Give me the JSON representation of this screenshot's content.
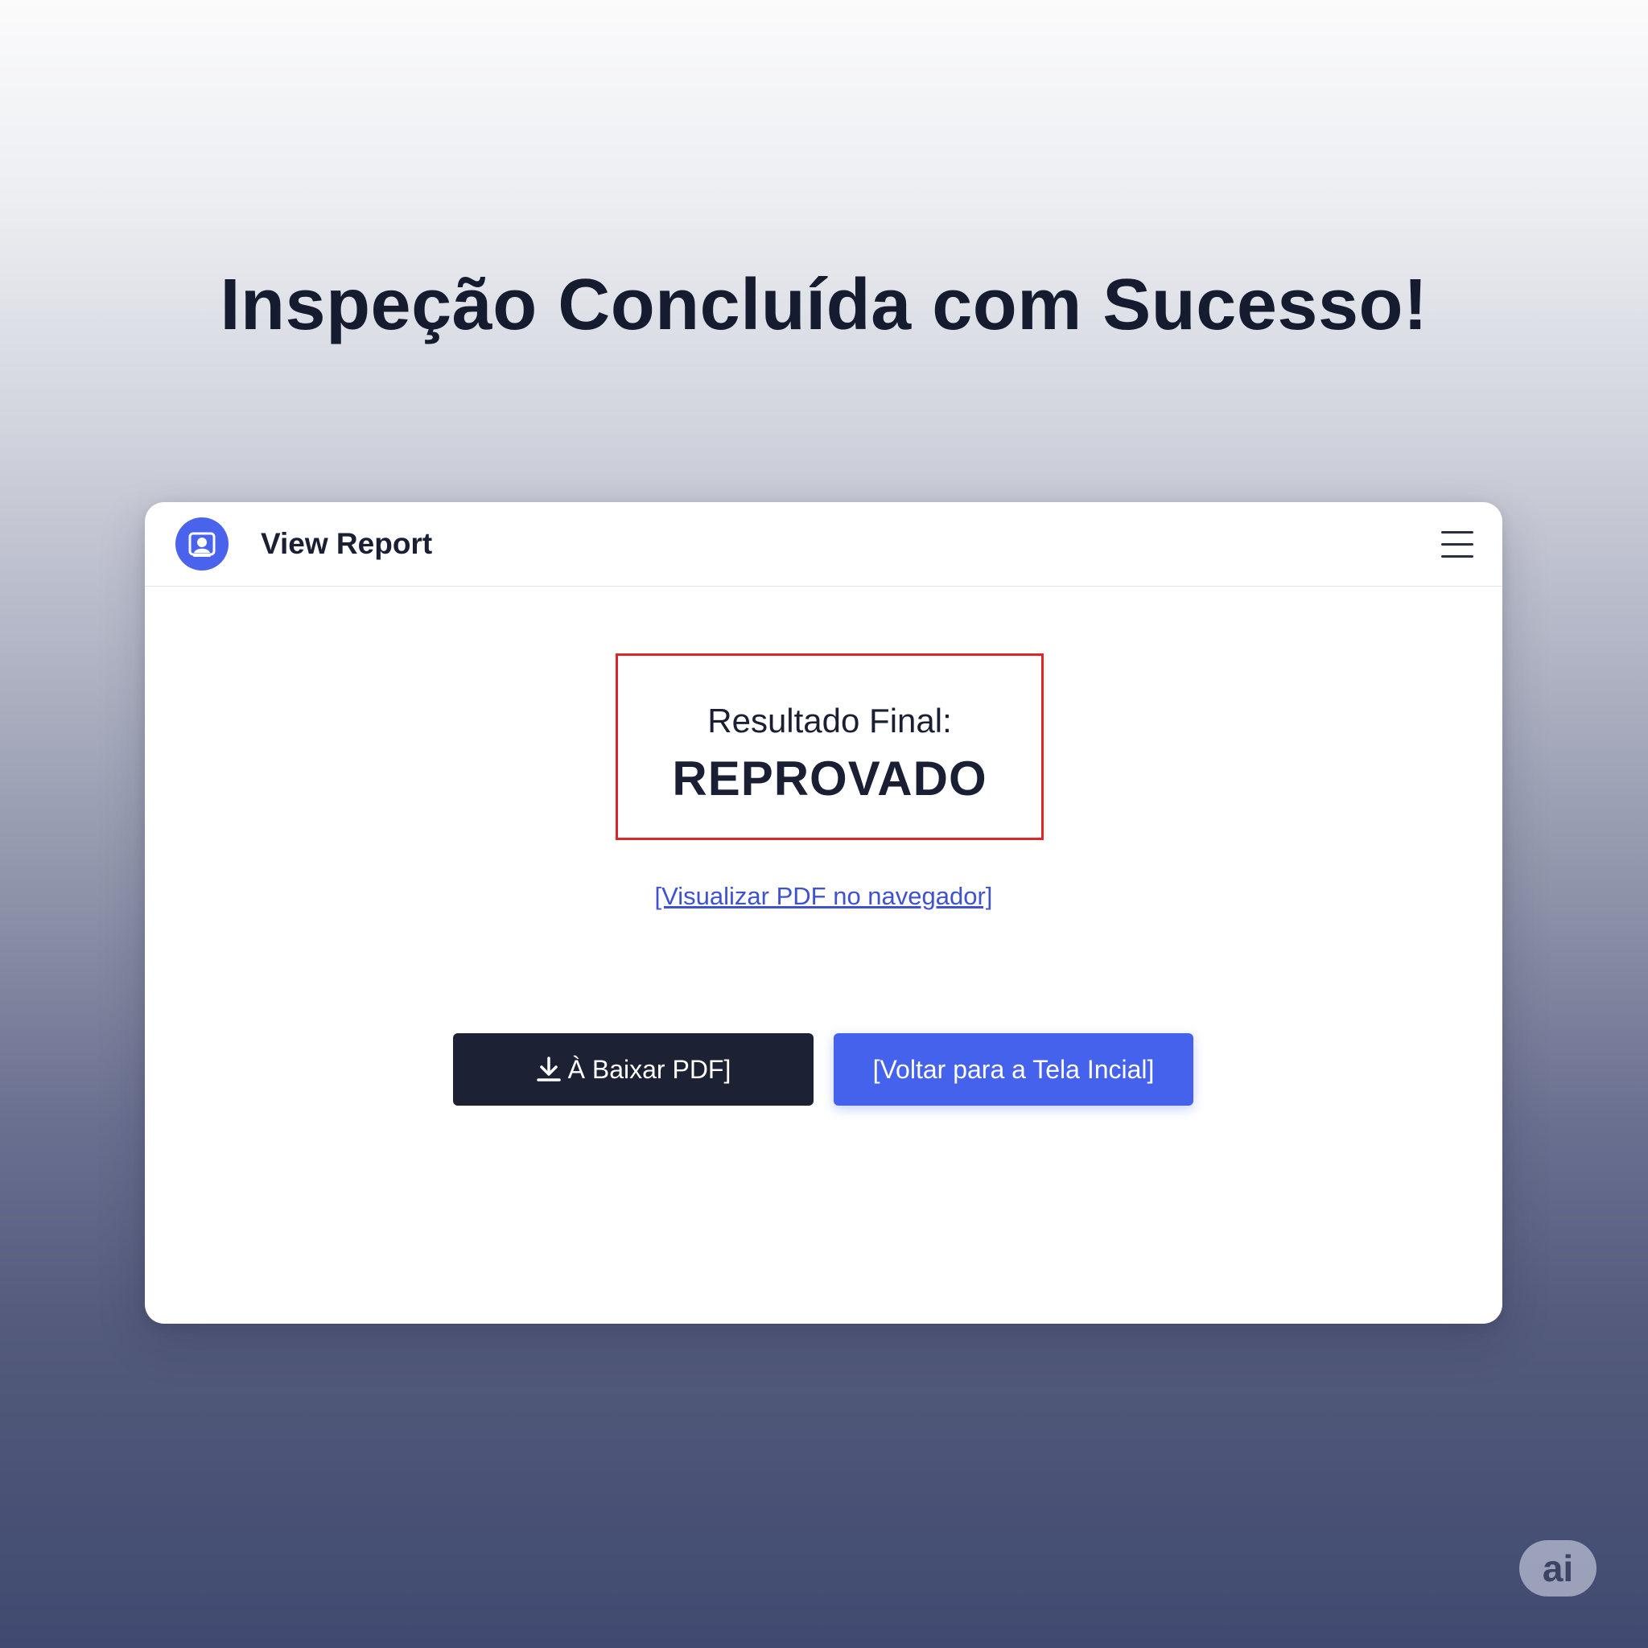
{
  "page": {
    "headline": "Inspeção Concluída com Sucesso!"
  },
  "header": {
    "title": "View Report",
    "logo_icon": "inspection-camera-icon",
    "menu_icon": "hamburger-menu-icon"
  },
  "result": {
    "label": "Resultado Final:",
    "value": "REPROVADO",
    "border_color": "#e0242a"
  },
  "links": {
    "view_pdf": "[Visualizar PDF no navegador]"
  },
  "buttons": {
    "download_label": "À Baixar PDF]",
    "download_icon": "download-icon",
    "back_label": "[Voltar para a Tela Incial]"
  },
  "badge": {
    "text": "ai"
  },
  "colors": {
    "accent": "#4562ec",
    "dark": "#1c2133",
    "link": "#3e52d2",
    "fail": "#e0242a"
  }
}
